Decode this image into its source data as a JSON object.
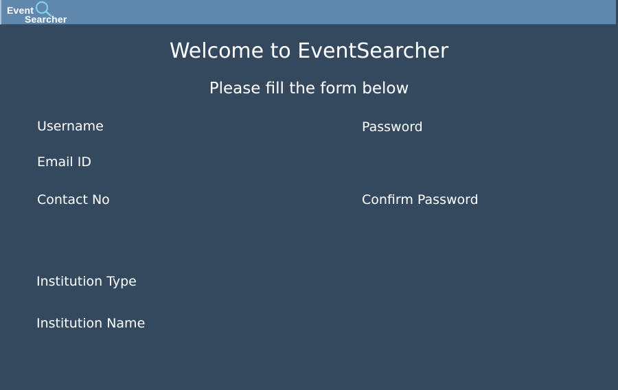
{
  "header": {
    "logo": {
      "word1": "Event",
      "word2": "Searcher",
      "icon": "magnifier-icon"
    }
  },
  "page": {
    "title": "Welcome to EventSearcher",
    "subtitle": "Please fill the form below"
  },
  "form": {
    "username_label": "Username",
    "password_label": "Password",
    "email_label": "Email ID",
    "contact_label": "Contact No",
    "confirm_password_label": "Confirm Password",
    "institution_type_label": "Institution Type",
    "institution_name_label": "Institution Name"
  },
  "colors": {
    "background": "#34495e",
    "topbar": "#5f88ac",
    "text": "#ffffff",
    "logo_glass": "#7fd3e8"
  }
}
